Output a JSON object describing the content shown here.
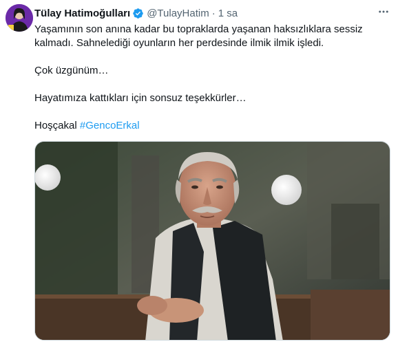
{
  "tweet": {
    "display_name": "Tülay Hatimoğulları",
    "handle": "@TulayHatim",
    "separator": "·",
    "time": "1 sa",
    "paragraphs": [
      "Yaşamının son anına kadar bu topraklarda yaşanan haksızlıklara sessiz kalmadı. Sahnelediği oyunların her perdesinde ilmik ilmik işledi.",
      "Çok üzgünüm…",
      "Hayatımıza kattıkları için sonsuz teşekkürler…"
    ],
    "closing_text": "Hoşçakal",
    "hashtag": "#GencoErkal",
    "verified": true,
    "more_icon": "more-horizontal-icon"
  },
  "colors": {
    "accent": "#1d9bf0",
    "secondary_text": "#536471",
    "primary_text": "#0f1419",
    "avatar_bg": "#6b2aa8"
  }
}
